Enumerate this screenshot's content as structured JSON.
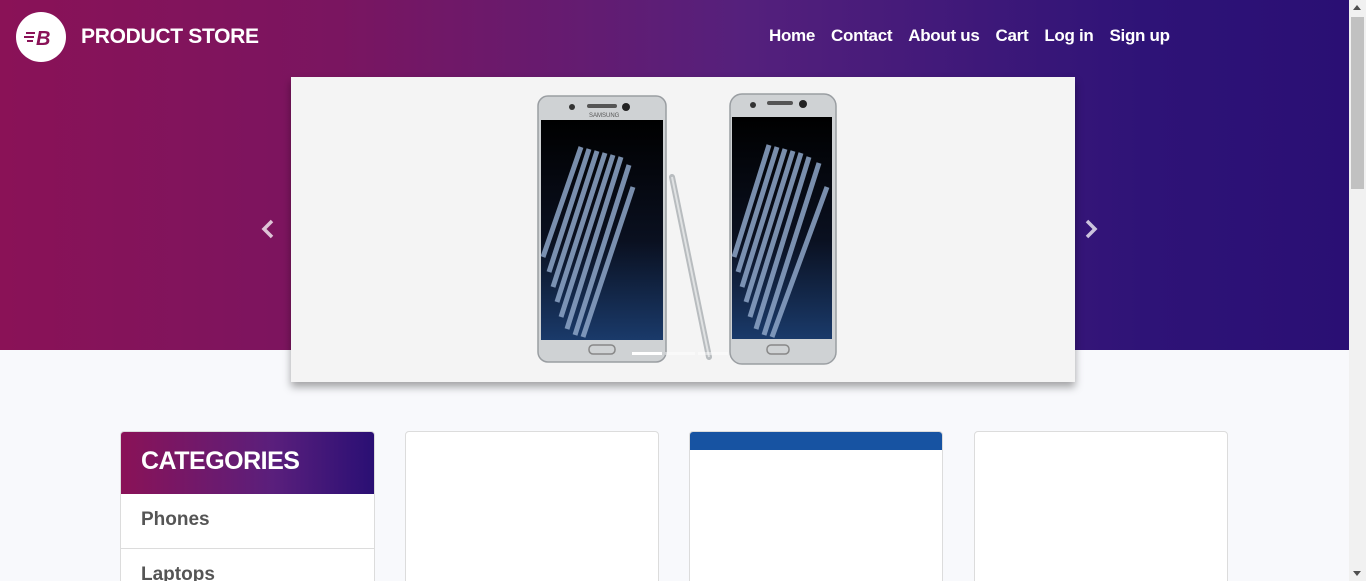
{
  "brand": {
    "name": "PRODUCT STORE",
    "logo_letter": "B"
  },
  "nav": {
    "items": [
      {
        "label": "Home"
      },
      {
        "label": "Contact"
      },
      {
        "label": "About us"
      },
      {
        "label": "Cart"
      },
      {
        "label": "Log in"
      },
      {
        "label": "Sign up"
      }
    ]
  },
  "carousel": {
    "slide_image": "samsung-phone-pair-with-stylus",
    "slide_count": 3,
    "active_slide": 1,
    "phone_brand": "SAMSUNG"
  },
  "categories": {
    "title": "CATEGORIES",
    "items": [
      {
        "label": "Phones"
      },
      {
        "label": "Laptops"
      }
    ]
  },
  "colors": {
    "gradient_start": "#8a1257",
    "gradient_end": "#2a0f74",
    "card_band": "#1753a2"
  }
}
